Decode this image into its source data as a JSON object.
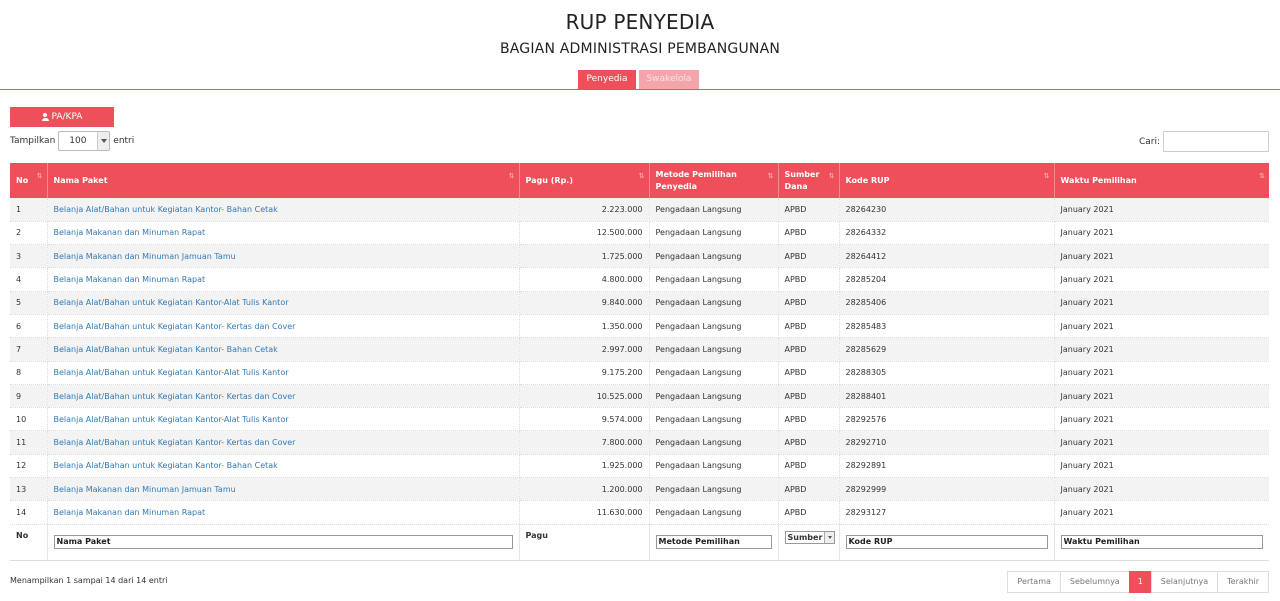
{
  "header": {
    "title": "RUP PENYEDIA",
    "subtitle": "BAGIAN ADMINISTRASI PEMBANGUNAN"
  },
  "tabs": [
    {
      "label": "Penyedia",
      "active": true
    },
    {
      "label": "Swakelola",
      "active": false
    }
  ],
  "toolbar": {
    "pa_button_label": "PA/KPA",
    "show_label_before": "Tampilkan",
    "page_length": "100",
    "show_label_after": "entri",
    "search_label": "Cari:",
    "search_value": ""
  },
  "table": {
    "columns": [
      "No",
      "Nama Paket",
      "Pagu (Rp.)",
      "Metode Pemilihan Penyedia",
      "Sumber Dana",
      "Kode RUP",
      "Waktu Pemilihan"
    ],
    "rows": [
      {
        "no": "1",
        "nama": "Belanja Alat/Bahan untuk Kegiatan Kantor- Bahan Cetak",
        "pagu": "2.223.000",
        "metode": "Pengadaan Langsung",
        "sumber": "APBD",
        "kode": "28264230",
        "waktu": "January 2021"
      },
      {
        "no": "2",
        "nama": "Belanja Makanan dan Minuman Rapat",
        "pagu": "12.500.000",
        "metode": "Pengadaan Langsung",
        "sumber": "APBD",
        "kode": "28264332",
        "waktu": "January 2021"
      },
      {
        "no": "3",
        "nama": "Belanja Makanan dan Minuman Jamuan Tamu",
        "pagu": "1.725.000",
        "metode": "Pengadaan Langsung",
        "sumber": "APBD",
        "kode": "28264412",
        "waktu": "January 2021"
      },
      {
        "no": "4",
        "nama": "Belanja Makanan dan Minuman Rapat",
        "pagu": "4.800.000",
        "metode": "Pengadaan Langsung",
        "sumber": "APBD",
        "kode": "28285204",
        "waktu": "January 2021"
      },
      {
        "no": "5",
        "nama": "Belanja Alat/Bahan untuk Kegiatan Kantor-Alat Tulis Kantor",
        "pagu": "9.840.000",
        "metode": "Pengadaan Langsung",
        "sumber": "APBD",
        "kode": "28285406",
        "waktu": "January 2021"
      },
      {
        "no": "6",
        "nama": "Belanja Alat/Bahan untuk Kegiatan Kantor- Kertas dan Cover",
        "pagu": "1.350.000",
        "metode": "Pengadaan Langsung",
        "sumber": "APBD",
        "kode": "28285483",
        "waktu": "January 2021"
      },
      {
        "no": "7",
        "nama": "Belanja Alat/Bahan untuk Kegiatan Kantor- Bahan Cetak",
        "pagu": "2.997.000",
        "metode": "Pengadaan Langsung",
        "sumber": "APBD",
        "kode": "28285629",
        "waktu": "January 2021"
      },
      {
        "no": "8",
        "nama": "Belanja Alat/Bahan untuk Kegiatan Kantor-Alat Tulis Kantor",
        "pagu": "9.175.200",
        "metode": "Pengadaan Langsung",
        "sumber": "APBD",
        "kode": "28288305",
        "waktu": "January 2021"
      },
      {
        "no": "9",
        "nama": "Belanja Alat/Bahan untuk Kegiatan Kantor- Kertas dan Cover",
        "pagu": "10.525.000",
        "metode": "Pengadaan Langsung",
        "sumber": "APBD",
        "kode": "28288401",
        "waktu": "January 2021"
      },
      {
        "no": "10",
        "nama": "Belanja Alat/Bahan untuk Kegiatan Kantor-Alat Tulis Kantor",
        "pagu": "9.574.000",
        "metode": "Pengadaan Langsung",
        "sumber": "APBD",
        "kode": "28292576",
        "waktu": "January 2021"
      },
      {
        "no": "11",
        "nama": "Belanja Alat/Bahan untuk Kegiatan Kantor- Kertas dan Cover",
        "pagu": "7.800.000",
        "metode": "Pengadaan Langsung",
        "sumber": "APBD",
        "kode": "28292710",
        "waktu": "January 2021"
      },
      {
        "no": "12",
        "nama": "Belanja Alat/Bahan untuk Kegiatan Kantor- Bahan Cetak",
        "pagu": "1.925.000",
        "metode": "Pengadaan Langsung",
        "sumber": "APBD",
        "kode": "28292891",
        "waktu": "January 2021"
      },
      {
        "no": "13",
        "nama": "Belanja Makanan dan Minuman Jamuan Tamu",
        "pagu": "1.200.000",
        "metode": "Pengadaan Langsung",
        "sumber": "APBD",
        "kode": "28292999",
        "waktu": "January 2021"
      },
      {
        "no": "14",
        "nama": "Belanja Makanan dan Minuman Rapat",
        "pagu": "11.630.000",
        "metode": "Pengadaan Langsung",
        "sumber": "APBD",
        "kode": "28293127",
        "waktu": "January 2021"
      }
    ],
    "footer": {
      "no_label": "No",
      "nama_placeholder": "Nama Paket",
      "pagu_label": "Pagu",
      "metode_placeholder": "Metode Pemilihan",
      "sumber_select": "Sumber",
      "kode_placeholder": "Kode RUP",
      "waktu_placeholder": "Waktu Pemilihan"
    }
  },
  "info_text": "Menampilkan 1 sampai 14 dari 14 entri",
  "pagination": {
    "first": "Pertama",
    "prev": "Sebelumnya",
    "current": "1",
    "next": "Selanjutnya",
    "last": "Terakhir"
  },
  "colors": {
    "accent": "#ee4f5a",
    "accent_light": "#f4a5ab",
    "link": "#337ab7"
  },
  "icons": {
    "pa_button": "user-icon",
    "sort": "sort-icon"
  }
}
